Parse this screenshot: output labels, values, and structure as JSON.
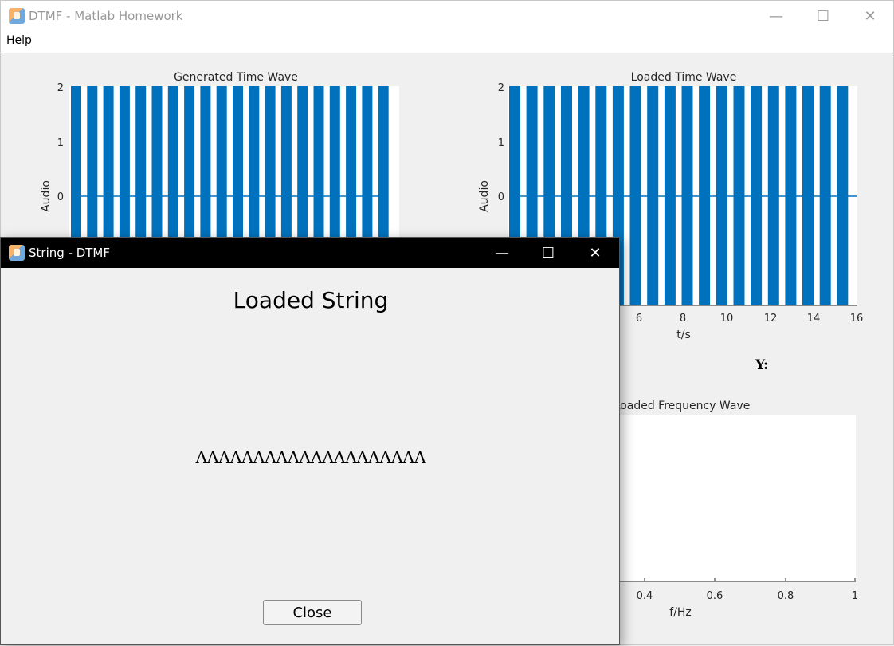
{
  "main_window": {
    "title": "DTMF - Matlab Homework",
    "menu": {
      "help_label": "Help"
    },
    "y_label": "Y:"
  },
  "charts": {
    "generated_time": {
      "title": "Generated Time Wave",
      "ylabel": "Audio",
      "yticks": [
        "2",
        "1",
        "0"
      ]
    },
    "loaded_time": {
      "title": "Loaded Time Wave",
      "ylabel": "Audio",
      "xlabel": "t/s",
      "yticks": [
        "2",
        "1",
        "0"
      ],
      "xticks": [
        "6",
        "8",
        "10",
        "12",
        "14",
        "16"
      ]
    },
    "loaded_freq": {
      "title": "Loaded Frequency Wave",
      "xlabel": "f/Hz",
      "xticks": [
        "0.4",
        "0.6",
        "0.8",
        "1"
      ]
    }
  },
  "chart_data": [
    {
      "type": "bar",
      "title": "Generated Time Wave",
      "ylabel": "Audio",
      "ylim": [
        -2,
        2
      ],
      "color": "#0072bd",
      "tone_bursts": 20
    },
    {
      "type": "bar",
      "title": "Loaded Time Wave",
      "ylabel": "Audio",
      "xlabel": "t/s",
      "xlim": [
        0,
        16
      ],
      "ylim": [
        -2,
        2
      ],
      "color": "#0072bd",
      "tone_bursts": 20
    },
    {
      "type": "line",
      "title": "Loaded Frequency Wave",
      "xlabel": "f/Hz",
      "xlim": [
        0,
        1
      ],
      "series": []
    }
  ],
  "dialog": {
    "title": "String - DTMF",
    "heading": "Loaded String",
    "string_value": "AAAAAAAAAAAAAAAAAAAA",
    "close_label": "Close"
  },
  "colors": {
    "wave": "#0072bd",
    "dialog_titlebar": "#000000"
  }
}
